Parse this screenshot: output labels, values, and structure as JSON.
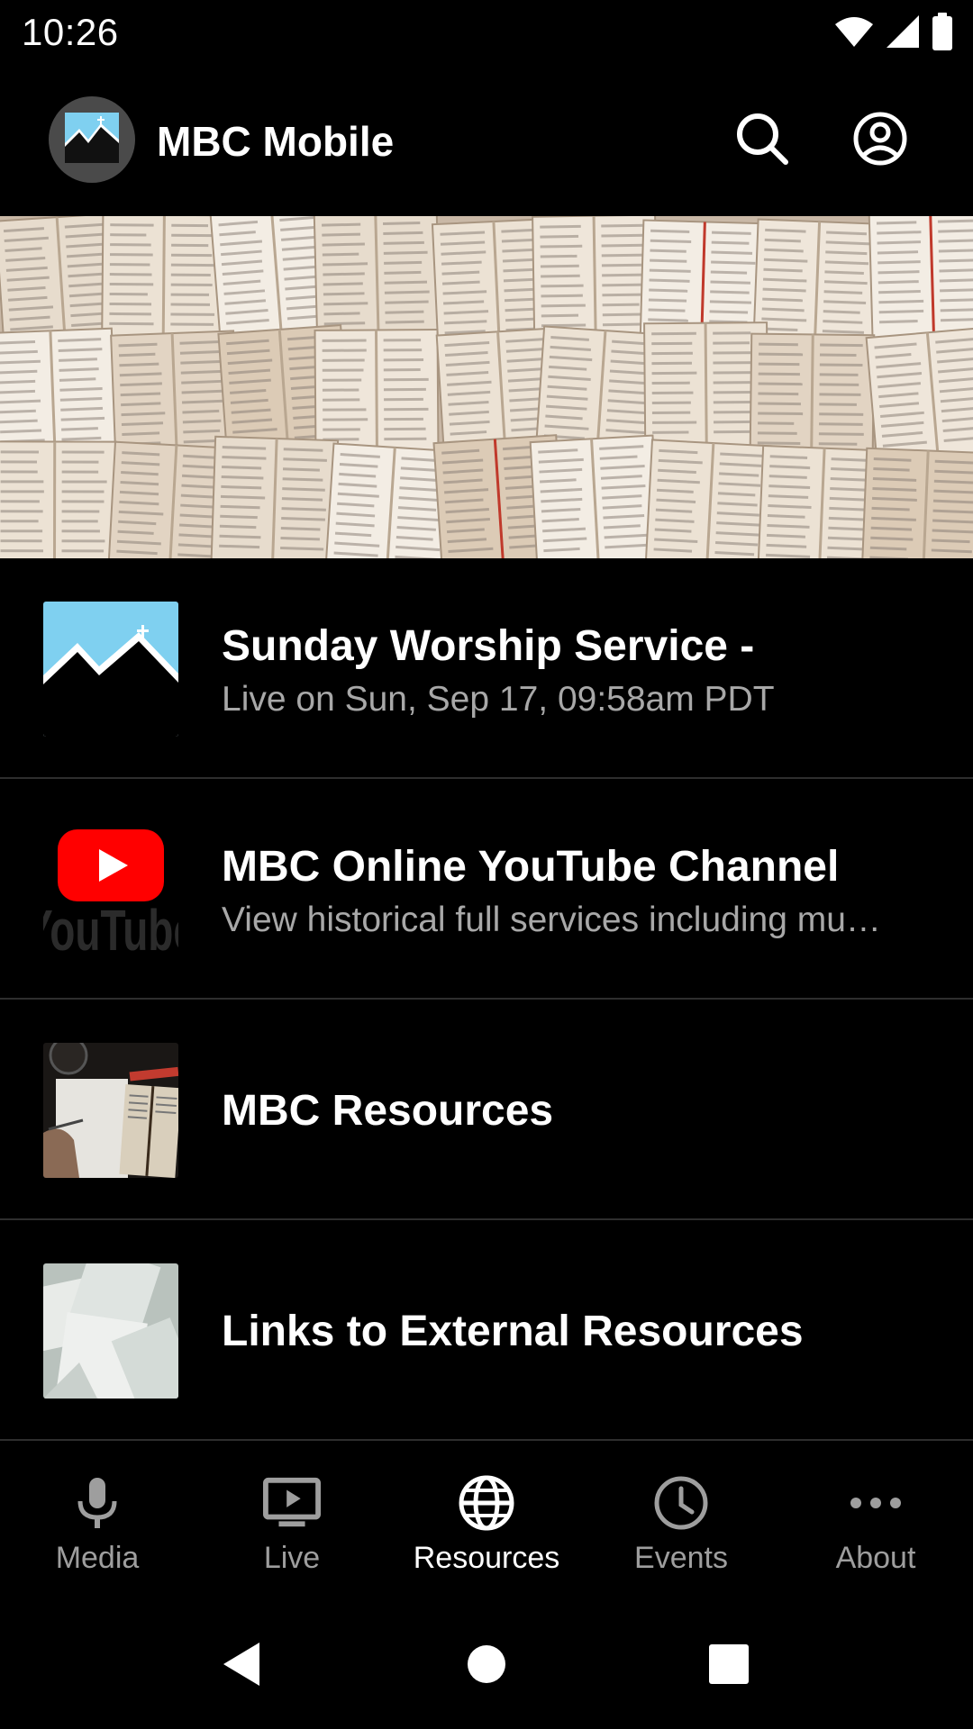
{
  "status_bar": {
    "time": "10:26",
    "icons": [
      "wifi-icon",
      "cellular-signal-icon",
      "battery-icon"
    ]
  },
  "app_bar": {
    "title": "MBC Mobile",
    "logo_icon": "mountain-cross-logo",
    "actions": [
      "search-icon",
      "account-circle-icon"
    ]
  },
  "list": {
    "items": [
      {
        "title": "Sunday Worship Service -",
        "subtitle": "Live on Sun, Sep 17, 09:58am PDT",
        "thumb": "mountain-cross-thumbnail"
      },
      {
        "title": "MBC Online YouTube Channel",
        "subtitle": "View historical full services including mu…",
        "thumb": "youtube-thumbnail",
        "thumb_text": "YouTube"
      },
      {
        "title": "MBC Resources",
        "thumb": "bible-desk-thumbnail"
      },
      {
        "title": "Links to External Resources",
        "thumb": "papers-thumbnail"
      }
    ]
  },
  "bottom_nav": {
    "items": [
      {
        "label": "Media",
        "icon": "microphone-icon"
      },
      {
        "label": "Live",
        "icon": "live-tv-icon"
      },
      {
        "label": "Resources",
        "icon": "globe-icon",
        "active": true
      },
      {
        "label": "Events",
        "icon": "clock-icon"
      },
      {
        "label": "About",
        "icon": "more-dots-icon"
      }
    ]
  },
  "system_nav": [
    "back-icon",
    "home-icon",
    "recents-icon"
  ],
  "colors": {
    "background": "#000000",
    "text_primary": "#ffffff",
    "text_secondary": "#a8a8a8",
    "nav_inactive": "#9e9e9e",
    "divider": "#2e2e2e",
    "youtube_red": "#ff0000",
    "sky_blue": "#7fd0f0"
  }
}
